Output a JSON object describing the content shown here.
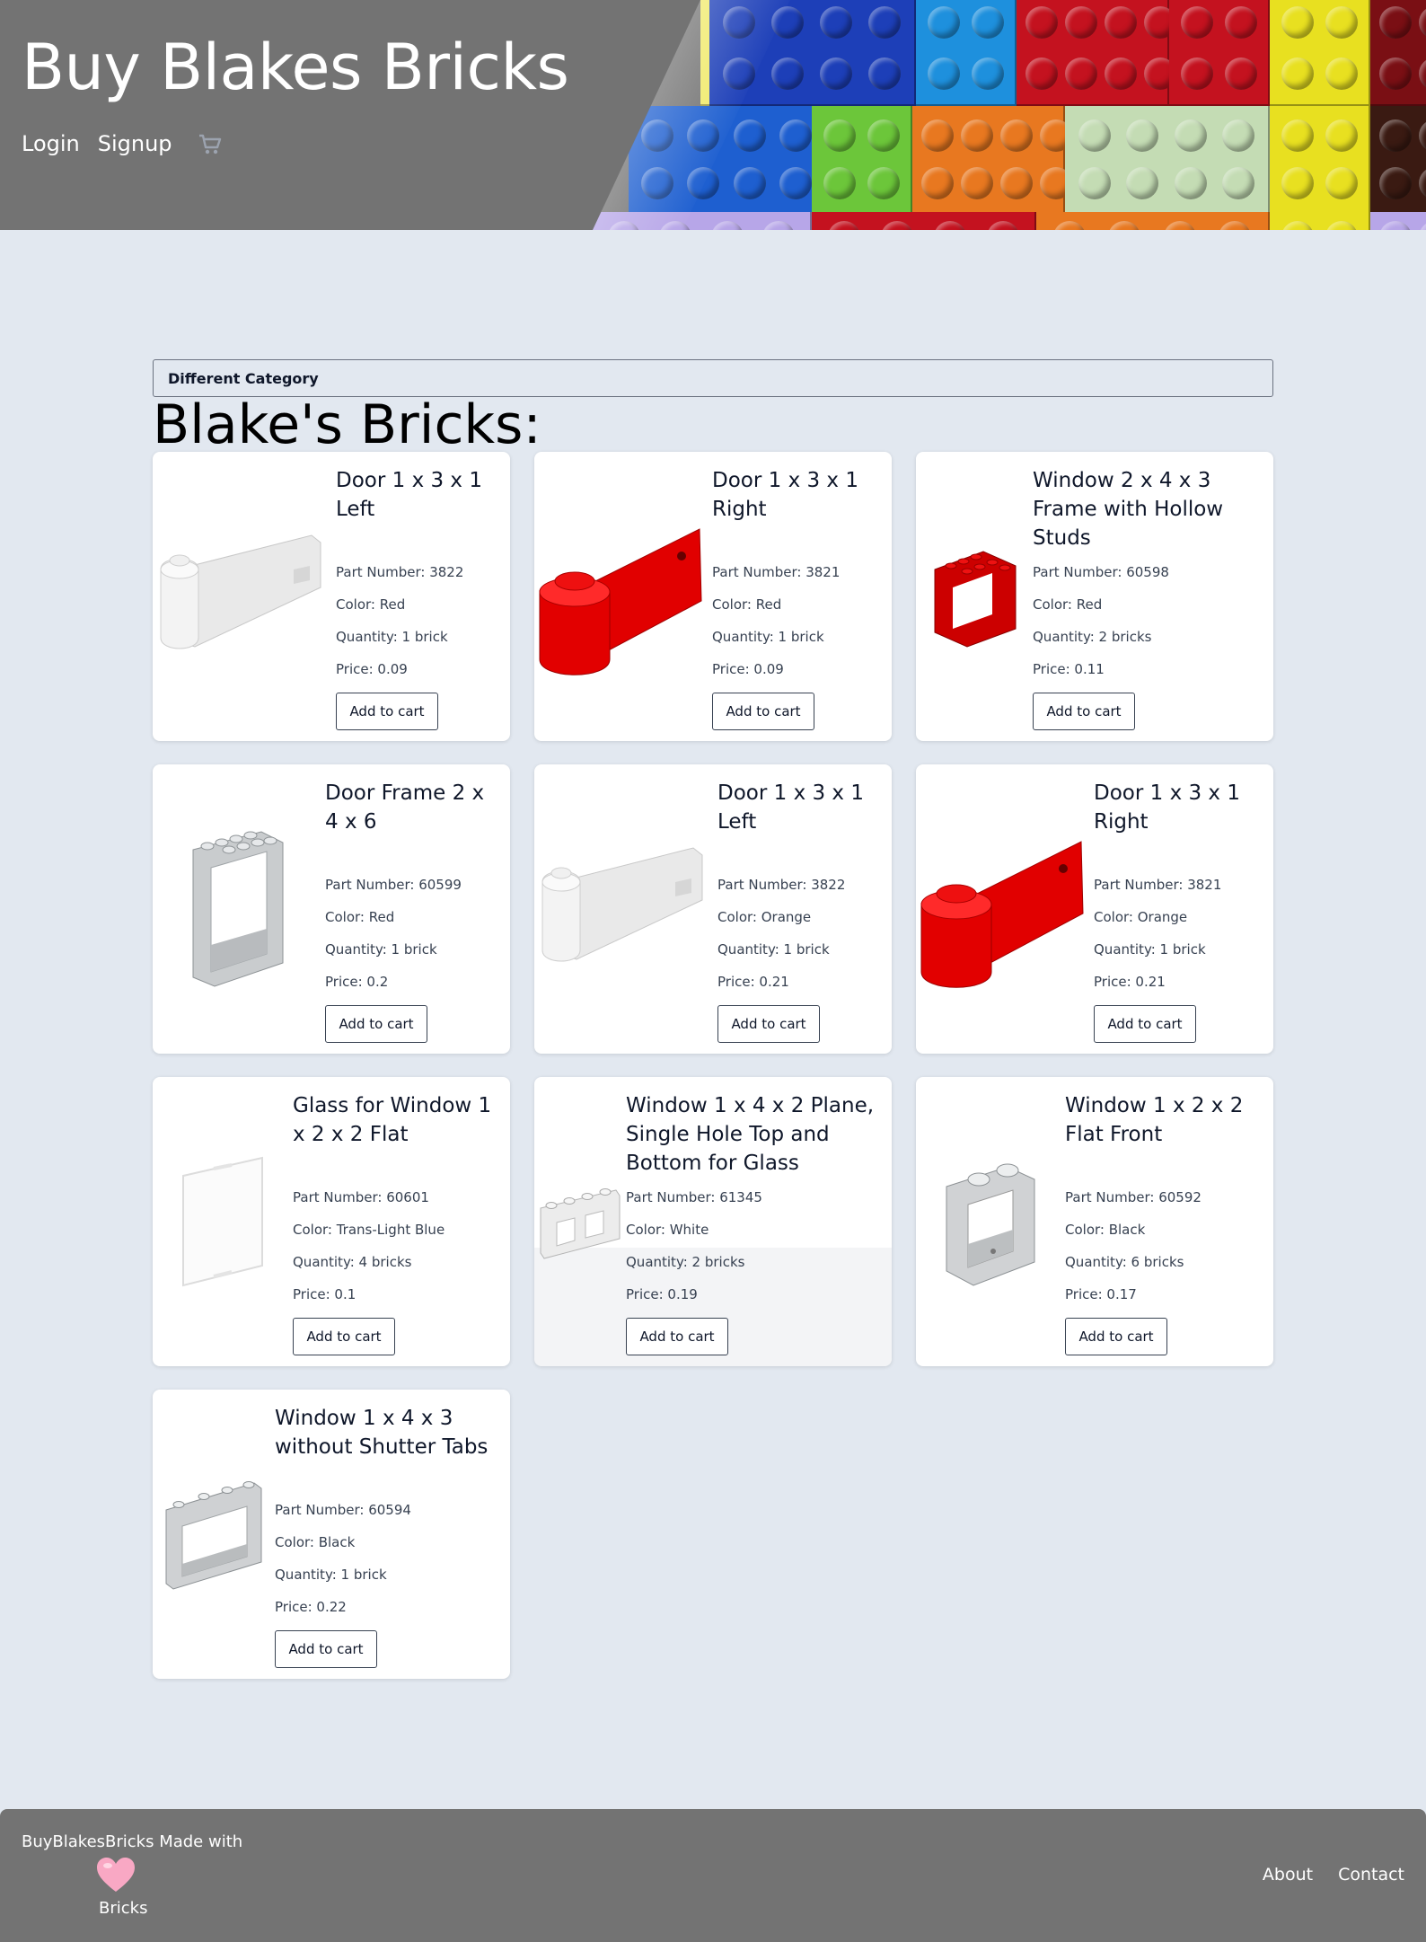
{
  "header": {
    "title": "Buy Blakes Bricks",
    "nav": {
      "login": "Login",
      "signup": "Signup"
    },
    "cart_icon": "cart-icon"
  },
  "main": {
    "category_button": "Different Category",
    "section_title": "Blake's Bricks:",
    "add_to_cart_label": "Add to cart",
    "products": [
      {
        "name": "Door 1 x 3 x 1 Left",
        "part": "Part Number: 3822",
        "color": "Color: Red",
        "quantity": "Quantity: 1 brick",
        "price": "Price: 0.09",
        "image": "door-left-white"
      },
      {
        "name": "Door 1 x 3 x 1 Right",
        "part": "Part Number: 3821",
        "color": "Color: Red",
        "quantity": "Quantity: 1 brick",
        "price": "Price: 0.09",
        "image": "door-right-red"
      },
      {
        "name": "Window 2 x 4 x 3 Frame with Hollow Studs",
        "part": "Part Number: 60598",
        "color": "Color: Red",
        "quantity": "Quantity: 2 bricks",
        "price": "Price: 0.11",
        "image": "window-frame-red"
      },
      {
        "name": "Door Frame 2 x 4 x 6",
        "part": "Part Number: 60599",
        "color": "Color: Red",
        "quantity": "Quantity: 1 brick",
        "price": "Price: 0.2",
        "image": "door-frame-grey"
      },
      {
        "name": "Door 1 x 3 x 1 Left",
        "part": "Part Number: 3822",
        "color": "Color: Orange",
        "quantity": "Quantity: 1 brick",
        "price": "Price: 0.21",
        "image": "door-left-white"
      },
      {
        "name": "Door 1 x 3 x 1 Right",
        "part": "Part Number: 3821",
        "color": "Color: Orange",
        "quantity": "Quantity: 1 brick",
        "price": "Price: 0.21",
        "image": "door-right-red"
      },
      {
        "name": "Glass for Window 1 x 2 x 2 Flat",
        "part": "Part Number: 60601",
        "color": "Color: Trans-Light Blue",
        "quantity": "Quantity: 4 bricks",
        "price": "Price: 0.1",
        "image": "glass-pane"
      },
      {
        "name": "Window 1 x 4 x 2 Plane, Single Hole Top and Bottom for Glass",
        "part": "Part Number: 61345",
        "color": "Color: White",
        "quantity": "Quantity: 2 bricks",
        "price": "Price: 0.19",
        "image": "window-plane-white"
      },
      {
        "name": "Window 1 x 2 x 2 Flat Front",
        "part": "Part Number: 60592",
        "color": "Color: Black",
        "quantity": "Quantity: 6 bricks",
        "price": "Price: 0.17",
        "image": "window-small-grey"
      },
      {
        "name": "Window 1 x 4 x 3 without Shutter Tabs",
        "part": "Part Number: 60594",
        "color": "Color: Black",
        "quantity": "Quantity: 1 brick",
        "price": "Price: 0.22",
        "image": "window-wide-grey"
      }
    ]
  },
  "footer": {
    "made_with": "BuyBlakesBricks Made with",
    "heart_icon": "heart-icon",
    "bricks_label": "Bricks",
    "about": "About",
    "contact": "Contact"
  }
}
